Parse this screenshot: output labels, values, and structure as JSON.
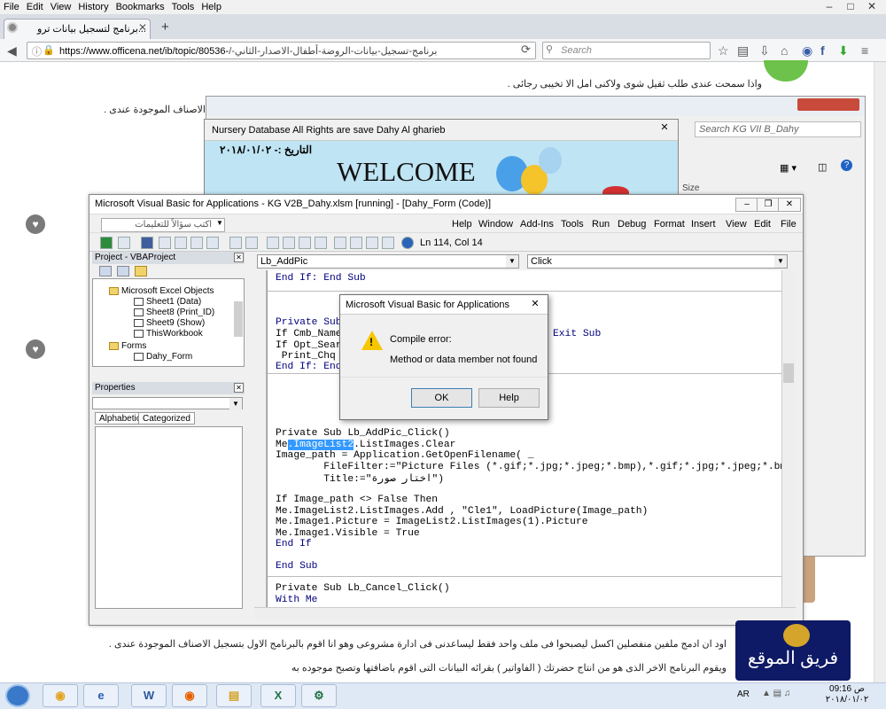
{
  "firefox": {
    "menu": [
      "File",
      "Edit",
      "View",
      "History",
      "Bookmarks",
      "Tools",
      "Help"
    ],
    "tab_title": "...برنامج لتسجيل بيانات ترو",
    "new_tab": "+",
    "url": "https://www.officena.net/ib/topic/80536-",
    "url_path": "برنامج-تسجيل-بيانات-الروضة-أطفال-الاصدار-الثاني-/",
    "search_placeholder": "Search"
  },
  "page": {
    "line1": "واذا سمحت عندى طلب ثقيل شوى ولاكنى امل الا تخيبى رجائى .",
    "line2": "الاصناف الموجودة عندى .",
    "bottom1": "اود ان ادمج ملفين منفصلين اكسل ليصبحوا فى ملف واحد فقط ليساعدنى فى ادارة مشروعى وهو انا اقوم بالبرنامج الاول بتسجيل الاصناف الموجودة عندى .",
    "bottom2": "ويقوم البرنامج الاخر الذى هو من انتاج حضرتك ( الفاواتير ) بقرائه البيانات التى اقوم باضافتها وتصبح موجوده به",
    "team_logo": "فريق الموقع"
  },
  "explorer": {
    "search_placeholder": "Search KG VII B_Dahy",
    "column_size": "Size"
  },
  "nursery": {
    "title": "Nursery Database All Rights are save Dahy Al gharieb",
    "date_label": "التاريخ :- ٢٠١٨/٠١/٠٢",
    "welcome": "WELCOME"
  },
  "vba": {
    "title": "Microsoft Visual Basic for Applications - KG V2B_Dahy.xlsm [running] - [Dahy_Form (Code)]",
    "menu": [
      "Help",
      "Window",
      "Add-Ins",
      "Tools",
      "Run",
      "Debug",
      "Format",
      "Insert",
      "View",
      "Edit",
      "File"
    ],
    "ask_placeholder": "اكتب سؤالاً للتعليمات",
    "position": "Ln 114, Col 14",
    "project_title": "Project - VBAProject",
    "tree": [
      "Microsoft Excel Objects",
      "Sheet1 (Data)",
      "Sheet8 (Print_ID)",
      "Sheet9 (Show)",
      "ThisWorkbook",
      "Forms",
      "Dahy_Form"
    ],
    "properties_title": "Properties",
    "tab_alphabetic": "Alphabetic",
    "tab_categorized": "Categorized",
    "object_combo": "Lb_AddPic",
    "proc_combo": "Click",
    "code": {
      "l1": "End If: End Sub",
      "l2": "Private Sub",
      "l3": "If Cmb_Name.",
      "l3b": "Exit Sub",
      "l4": "If Opt_Searc",
      "l5": " Print_Chq",
      "l6": "End If: End",
      "l7": "Private Sub Lb_AddPic_Click()",
      "l8a": "Me",
      "l8sel": ".ImageList2",
      "l8b": ".ListImages.Clear",
      "l9": "Image_path = Application.GetOpenFilename( _",
      "l10": "        FileFilter:=\"Picture Files (*.gif;*.jpg;*.jpeg;*.bmp),*.gif;*.jpg;*.jpeg;*.bmp\", _",
      "l11": "        Title:=\"اختار صورة\")",
      "l12": "If Image_path <> False Then",
      "l13": "Me.ImageList2.ListImages.Add , \"Cle1\", LoadPicture(Image_path)",
      "l14": "Me.Image1.Picture = ImageList2.ListImages(1).Picture",
      "l15": "Me.Image1.Visible = True",
      "l16": "End If",
      "l17": "End Sub",
      "l18": "Private Sub Lb_Cancel_Click()",
      "l19": "With Me"
    }
  },
  "dialog": {
    "title": "Microsoft Visual Basic for Applications",
    "heading": "Compile error:",
    "message": "Method or data member not found",
    "ok": "OK",
    "help": "Help"
  },
  "taskbar": {
    "lang": "AR",
    "time": "09:16 ص",
    "date": "٢٠١٨/٠١/٠٢"
  }
}
